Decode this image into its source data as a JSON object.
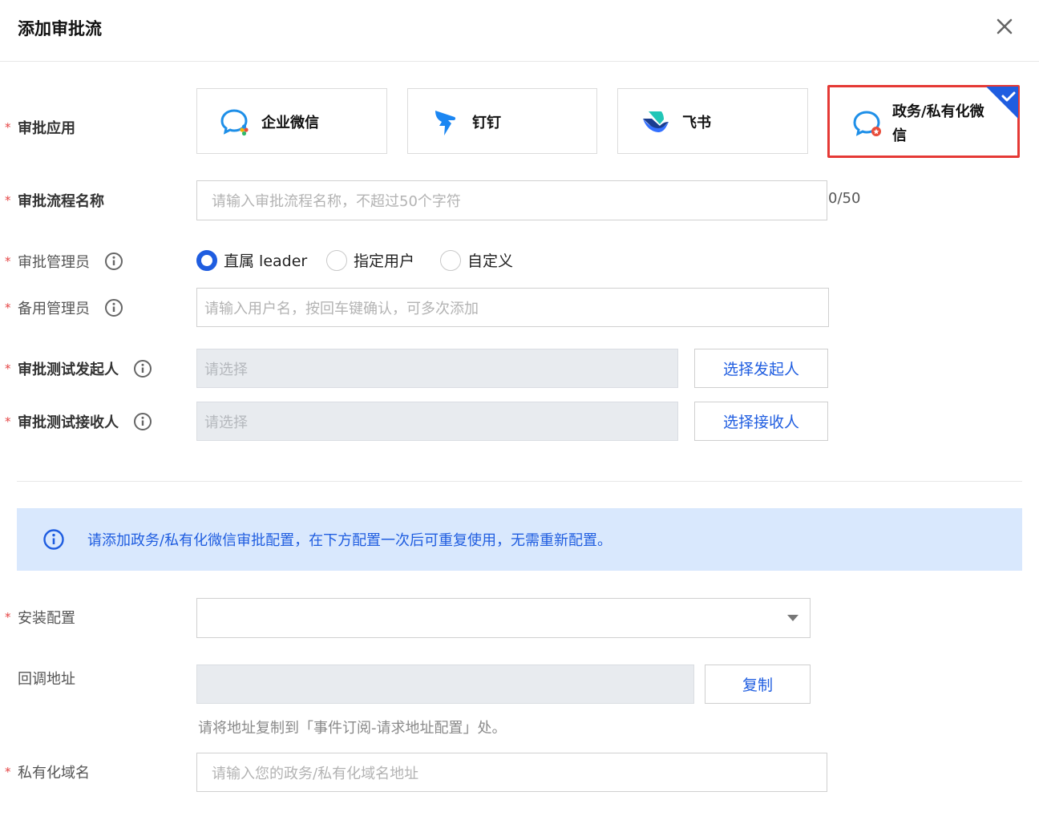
{
  "dialog": {
    "title": "添加审批流"
  },
  "fields": {
    "app": {
      "label": "审批应用"
    },
    "flow_name": {
      "label": "审批流程名称",
      "placeholder": "请输入审批流程名称，不超过50个字符",
      "counter": "0/50"
    },
    "admin": {
      "label": "审批管理员"
    },
    "backup_admin": {
      "label": "备用管理员",
      "placeholder": "请输入用户名，按回车键确认，可多次添加"
    },
    "test_sender": {
      "label": "审批测试发起人",
      "placeholder": "请选择",
      "button": "选择发起人"
    },
    "test_receiver": {
      "label": "审批测试接收人",
      "placeholder": "请选择",
      "button": "选择接收人"
    },
    "install": {
      "label": "安装配置",
      "value": ""
    },
    "callback": {
      "label": "回调地址",
      "value": "",
      "button": "复制",
      "hint": "请将地址复制到「事件订阅-请求地址配置」处。"
    },
    "domain": {
      "label": "私有化域名",
      "placeholder": "请输入您的政务/私有化域名地址"
    }
  },
  "apps": [
    {
      "name": "企业微信",
      "icon": "wecom-icon",
      "selected": false
    },
    {
      "name": "钉钉",
      "icon": "dingtalk-icon",
      "selected": false
    },
    {
      "name": "飞书",
      "icon": "feishu-icon",
      "selected": false
    },
    {
      "name_line1": "政务/私有化微",
      "name_line2": "信",
      "icon": "gov-wecom-icon",
      "selected": true
    }
  ],
  "admin_options": [
    {
      "label": "直属 leader",
      "selected": true
    },
    {
      "label": "指定用户",
      "selected": false
    },
    {
      "label": "自定义",
      "selected": false
    }
  ],
  "notice": {
    "text": "请添加政务/私有化微信审批配置，在下方配置一次后可重复使用，无需重新配置。"
  },
  "colors": {
    "primary": "#1f5de0",
    "required": "#e54545",
    "selected_border": "#e53935",
    "notice_bg": "#d9e8fd"
  }
}
